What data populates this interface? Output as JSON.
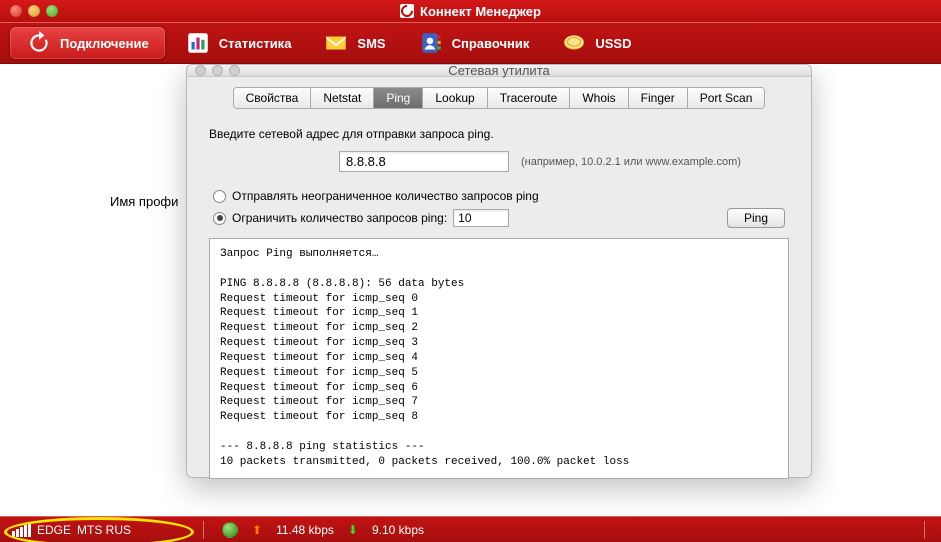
{
  "app": {
    "title": "Коннект Менеджер"
  },
  "nav": {
    "connect": "Подключение",
    "stats": "Статистика",
    "sms": "SMS",
    "contacts": "Справочник",
    "ussd": "USSD"
  },
  "main": {
    "profile_label": "Имя профи"
  },
  "netutil": {
    "title": "Сетевая утилита",
    "tabs": {
      "info": "Свойства",
      "netstat": "Netstat",
      "ping": "Ping",
      "lookup": "Lookup",
      "traceroute": "Traceroute",
      "whois": "Whois",
      "finger": "Finger",
      "portscan": "Port Scan"
    },
    "ping": {
      "instruction": "Введите сетевой адрес для отправки запроса ping.",
      "address": "8.8.8.8",
      "hint": "(например, 10.0.2.1 или www.example.com)",
      "radio_unlimited": "Отправлять неограниченное количество запросов ping",
      "radio_limited": "Ограничить количество запросов ping:",
      "count": "10",
      "button": "Ping",
      "output": "Запрос Ping выполняется…\n\nPING 8.8.8.8 (8.8.8.8): 56 data bytes\nRequest timeout for icmp_seq 0\nRequest timeout for icmp_seq 1\nRequest timeout for icmp_seq 2\nRequest timeout for icmp_seq 3\nRequest timeout for icmp_seq 4\nRequest timeout for icmp_seq 5\nRequest timeout for icmp_seq 6\nRequest timeout for icmp_seq 7\nRequest timeout for icmp_seq 8\n\n--- 8.8.8.8 ping statistics ---\n10 packets transmitted, 0 packets received, 100.0% packet loss"
    }
  },
  "status": {
    "network_type": "EDGE",
    "operator": "MTS RUS",
    "upload": "11.48 kbps",
    "download": "9.10 kbps"
  }
}
